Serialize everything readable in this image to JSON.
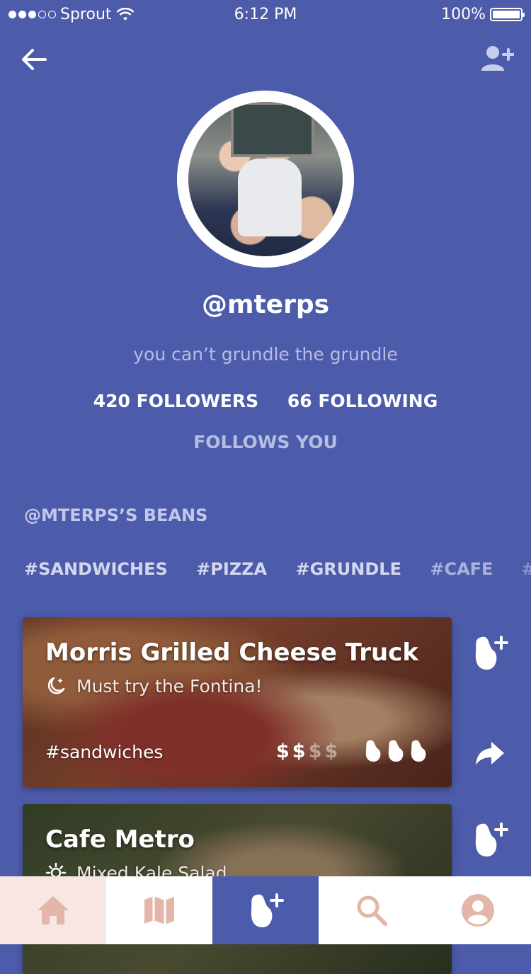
{
  "status_bar": {
    "carrier": "Sprout",
    "time": "6:12 PM",
    "battery": "100%"
  },
  "header": {
    "back_icon": "arrow-left-icon",
    "add_user_icon": "person-add-icon"
  },
  "profile": {
    "username": "@mterps",
    "bio": "you can’t grundle the grundle",
    "followers": "420 FOLLOWERS",
    "following": "66 FOLLOWING",
    "follows_you": "FOLLOWS YOU"
  },
  "beans_section": {
    "title": "@MTERPS’S BEANS",
    "tags": [
      "#SANDWICHES",
      "#PIZZA",
      "#GRUNDLE",
      "#CAFE",
      "#BAR",
      "#"
    ]
  },
  "cards": [
    {
      "title": "Morris Grilled Cheese Truck",
      "subtitle": "Must try the Fontina!",
      "time_icon": "moon-icon",
      "tag": "#sandwiches",
      "price_on": "$$",
      "price_off": "$$",
      "bean_rating": 3
    },
    {
      "title": "Cafe Metro",
      "subtitle": "Mixed Kale Salad",
      "time_icon": "sun-icon"
    }
  ],
  "tab_bar": {
    "items": [
      {
        "name": "home",
        "icon": "home-icon"
      },
      {
        "name": "map",
        "icon": "map-icon"
      },
      {
        "name": "add-bean",
        "icon": "bean-add-icon"
      },
      {
        "name": "search",
        "icon": "search-icon"
      },
      {
        "name": "profile",
        "icon": "person-icon"
      }
    ]
  },
  "colors": {
    "background": "#4d5bab",
    "tab_icon": "#e4b6a9",
    "tab_home_bg": "#f7e6e2"
  }
}
